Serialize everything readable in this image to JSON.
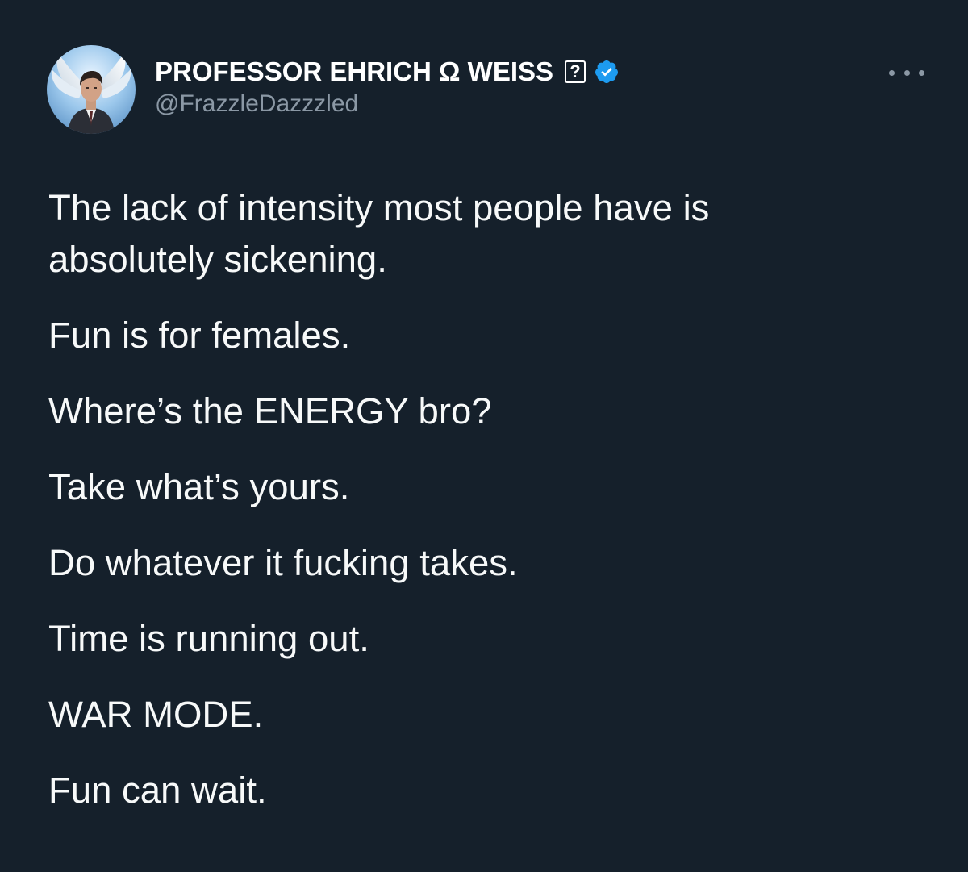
{
  "author": {
    "display_name": "PROFESSOR EHRICH Ω WEISS",
    "unknown_glyph": "?",
    "handle": "@FrazzleDazzzled",
    "verified_icon": "verified-badge-icon",
    "verified_color": "#1d9bf0"
  },
  "menu": {
    "icon": "more-options-icon"
  },
  "tweet": {
    "paragraphs": [
      "The lack of intensity most people have is\nabsolutely sickening.",
      "Fun is for females.",
      "Where’s the ENERGY bro?",
      "Take what’s yours.",
      "Do whatever it fucking takes.",
      "Time is running out.",
      "WAR MODE.",
      "Fun can wait."
    ]
  },
  "colors": {
    "background": "#15202b",
    "text": "#f7f9f9",
    "secondary_text": "#8b98a5"
  }
}
